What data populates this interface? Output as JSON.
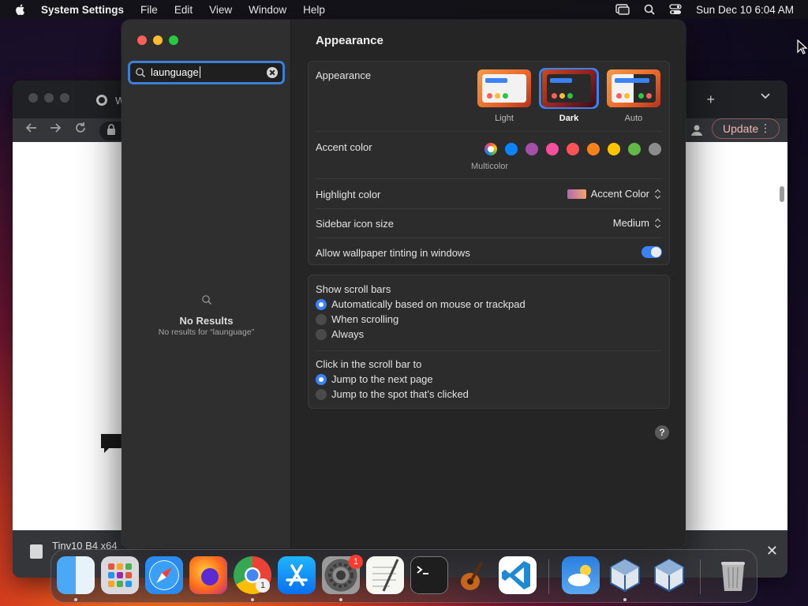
{
  "menubar": {
    "app_name": "System Settings",
    "menus": [
      "File",
      "Edit",
      "View",
      "Window",
      "Help"
    ],
    "datetime": "Sun Dec 10  6:04 AM"
  },
  "browser": {
    "tab_title_fragment": "W",
    "update_label": "Update",
    "download_text": "Tinv10 B4 x64"
  },
  "settings": {
    "search": {
      "value": "launguage"
    },
    "no_results": {
      "title": "No Results",
      "detail": "No results for “launguage”"
    },
    "page_title": "Appearance",
    "appearance": {
      "label": "Appearance",
      "options": [
        "Light",
        "Dark",
        "Auto"
      ],
      "selected": "Dark"
    },
    "accent": {
      "label": "Accent color",
      "multicolor_label": "Multicolor",
      "colors": [
        "#0a84ff",
        "#a550a7",
        "#f74f9e",
        "#ff5257",
        "#f7821b",
        "#ffc600",
        "#62ba46",
        "#8c8c8c"
      ]
    },
    "highlight": {
      "label": "Highlight color",
      "value": "Accent Color"
    },
    "sidebar_icon_size": {
      "label": "Sidebar icon size",
      "value": "Medium"
    },
    "wallpaper_tinting": {
      "label": "Allow wallpaper tinting in windows",
      "enabled": true
    },
    "scroll_bars": {
      "label": "Show scroll bars",
      "options": [
        "Automatically based on mouse or trackpad",
        "When scrolling",
        "Always"
      ],
      "selected_index": 0
    },
    "click_scroll": {
      "label": "Click in the scroll bar to",
      "options": [
        "Jump to the next page",
        "Jump to the spot that’s clicked"
      ],
      "selected_index": 0
    },
    "help_label": "?"
  },
  "dock": {
    "apps": [
      "Finder",
      "Launchpad",
      "Safari",
      "Firefox",
      "Chrome",
      "App Store",
      "System Settings",
      "TextEdit",
      "Terminal",
      "GarageBand",
      "VS Code",
      "Weather",
      "VirtualBox",
      "VirtualBox",
      "Trash"
    ],
    "settings_badge": "1",
    "chrome_badge": "1"
  }
}
